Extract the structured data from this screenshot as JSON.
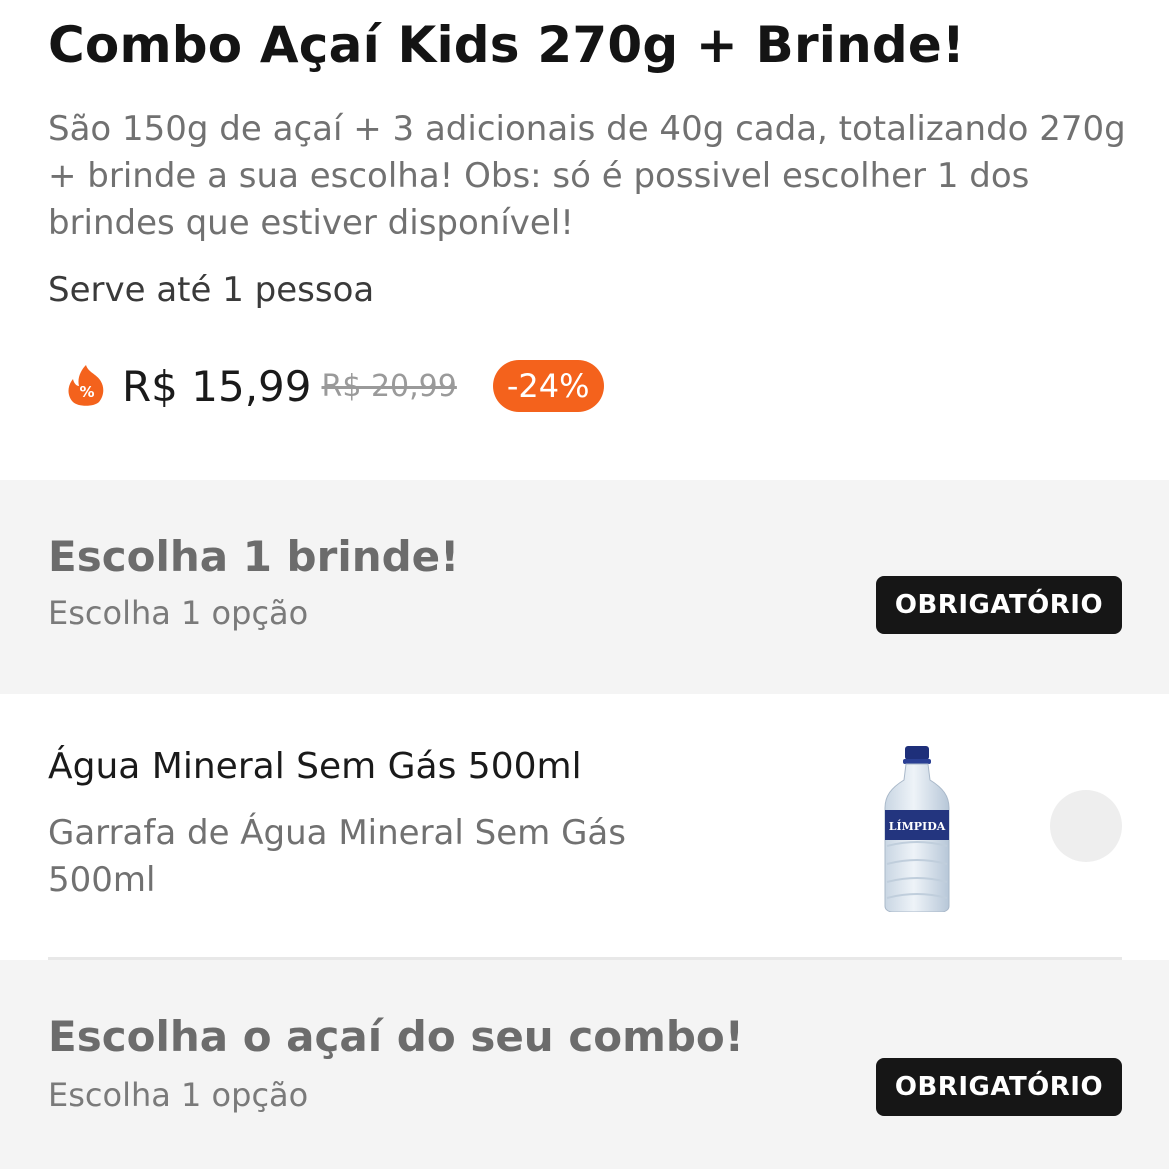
{
  "product": {
    "title": "Combo Açaí Kids 270g + Brinde!",
    "description": "São 150g de açaí + 3 adicionais de 40g cada, totalizando 270g + brinde a sua escolha! Obs: só é possivel escolher 1 dos brindes que estiver disponível!",
    "serves": "Serve até 1 pessoa",
    "price": "R$ 15,99",
    "old_price": "R$ 20,99",
    "discount": "-24%",
    "promo_icon_label": "%",
    "promo_icon": "flame-percent-icon"
  },
  "groups": [
    {
      "title": "Escolha 1 brinde!",
      "subtitle": "Escolha 1 opção",
      "badge": "OBRIGATÓRIO",
      "options": [
        {
          "name": "Água Mineral Sem Gás 500ml",
          "description": "Garrafa de Água Mineral Sem Gás 500ml",
          "image_label": "LÍMPIDA",
          "selected": false
        }
      ]
    },
    {
      "title": "Escolha o açaí do seu combo!",
      "subtitle": "Escolha 1 opção",
      "badge": "OBRIGATÓRIO"
    }
  ],
  "colors": {
    "accent": "#f4621c",
    "badge_bg": "#161616",
    "section_bg": "#f4f4f4",
    "text_muted": "#717171"
  }
}
